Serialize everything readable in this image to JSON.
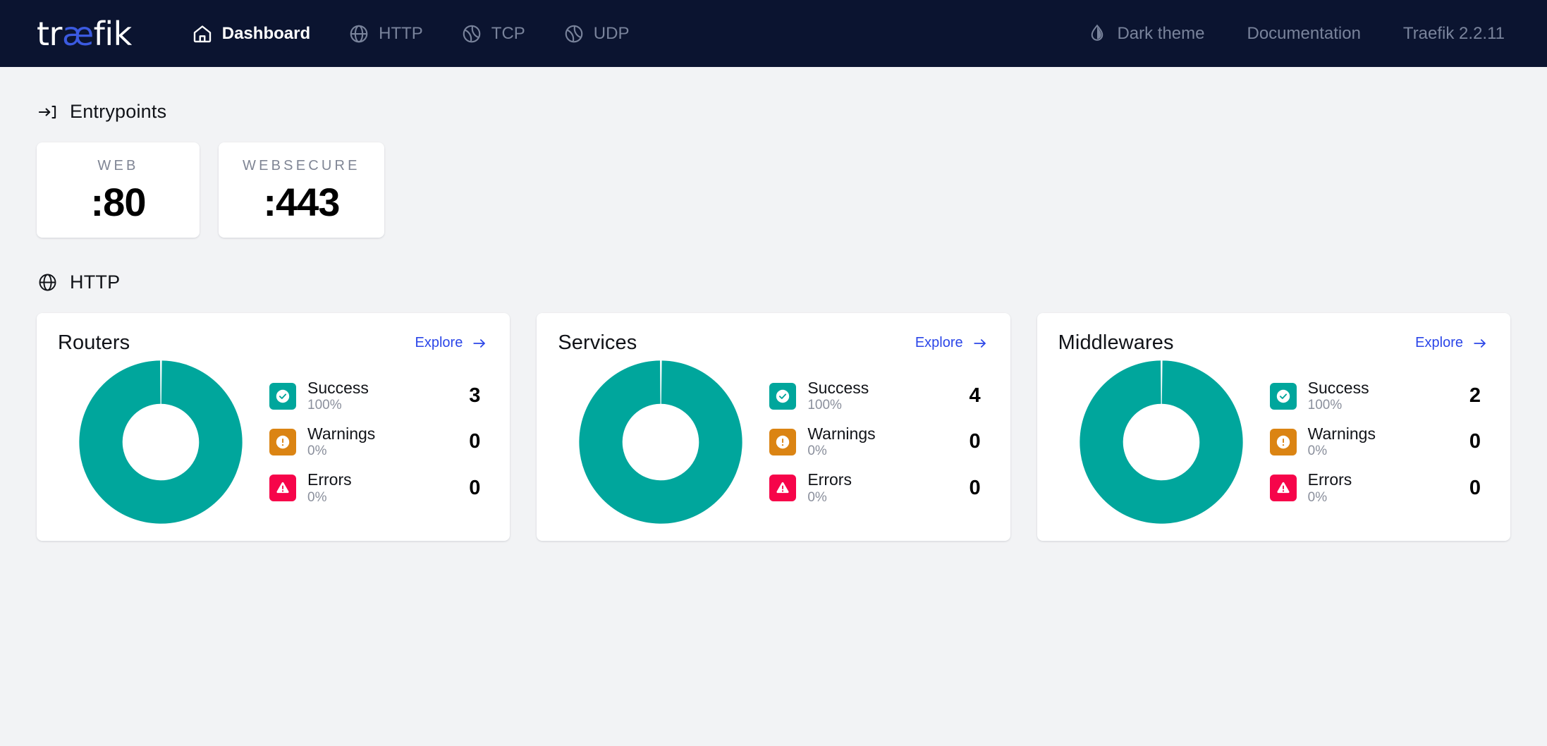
{
  "navbar": {
    "brand": {
      "part1": "tr",
      "part2": "æ",
      "part3": "fik"
    },
    "left_items": [
      {
        "label": "Dashboard",
        "icon": "home-icon",
        "active": true
      },
      {
        "label": "HTTP",
        "icon": "globe-icon",
        "active": false
      },
      {
        "label": "TCP",
        "icon": "sphere-icon",
        "active": false
      },
      {
        "label": "UDP",
        "icon": "sphere-icon",
        "active": false
      }
    ],
    "theme_toggle": {
      "label": "Dark theme",
      "icon": "droplet-half-icon"
    },
    "documentation": {
      "label": "Documentation"
    },
    "version": "Traefik 2.2.11",
    "bg_color": "#0B1430",
    "accent_color": "#3B5AE0"
  },
  "entrypoints_section": {
    "title": "Entrypoints",
    "icon": "arrow-into-bracket-icon",
    "cards": [
      {
        "name": "WEB",
        "port": ":80"
      },
      {
        "name": "WEBSECURE",
        "port": ":443"
      }
    ]
  },
  "http_section": {
    "title": "HTTP",
    "icon": "globe-icon",
    "explore_label": "Explore",
    "cards": [
      {
        "title": "Routers",
        "explore_label": "Explore",
        "legend": [
          {
            "name": "Success",
            "percent": "100%",
            "count": "3",
            "color": "#00A69C",
            "icon": "check-circle-icon"
          },
          {
            "name": "Warnings",
            "percent": "0%",
            "count": "0",
            "color": "#DB8413",
            "icon": "exclamation-circle-icon"
          },
          {
            "name": "Errors",
            "percent": "0%",
            "count": "0",
            "color": "#F6054A",
            "icon": "warning-triangle-icon"
          }
        ]
      },
      {
        "title": "Services",
        "explore_label": "Explore",
        "legend": [
          {
            "name": "Success",
            "percent": "100%",
            "count": "4",
            "color": "#00A69C",
            "icon": "check-circle-icon"
          },
          {
            "name": "Warnings",
            "percent": "0%",
            "count": "0",
            "color": "#DB8413",
            "icon": "exclamation-circle-icon"
          },
          {
            "name": "Errors",
            "percent": "0%",
            "count": "0",
            "color": "#F6054A",
            "icon": "warning-triangle-icon"
          }
        ]
      },
      {
        "title": "Middlewares",
        "explore_label": "Explore",
        "legend": [
          {
            "name": "Success",
            "percent": "100%",
            "count": "2",
            "color": "#00A69C",
            "icon": "check-circle-icon"
          },
          {
            "name": "Warnings",
            "percent": "0%",
            "count": "0",
            "color": "#DB8413",
            "icon": "exclamation-circle-icon"
          },
          {
            "name": "Errors",
            "percent": "0%",
            "count": "0",
            "color": "#F6054A",
            "icon": "warning-triangle-icon"
          }
        ]
      }
    ]
  },
  "chart_data": [
    {
      "type": "pie",
      "title": "Routers",
      "labels": [
        "Success",
        "Warnings",
        "Errors"
      ],
      "values": [
        3,
        0,
        0
      ],
      "percents": [
        100,
        0,
        0
      ],
      "colors": [
        "#00A69C",
        "#DB8413",
        "#F6054A"
      ],
      "donut": true,
      "legend_position": "right"
    },
    {
      "type": "pie",
      "title": "Services",
      "labels": [
        "Success",
        "Warnings",
        "Errors"
      ],
      "values": [
        4,
        0,
        0
      ],
      "percents": [
        100,
        0,
        0
      ],
      "colors": [
        "#00A69C",
        "#DB8413",
        "#F6054A"
      ],
      "donut": true,
      "legend_position": "right"
    },
    {
      "type": "pie",
      "title": "Middlewares",
      "labels": [
        "Success",
        "Warnings",
        "Errors"
      ],
      "values": [
        2,
        0,
        0
      ],
      "percents": [
        100,
        0,
        0
      ],
      "colors": [
        "#00A69C",
        "#DB8413",
        "#F6054A"
      ],
      "donut": true,
      "legend_position": "right"
    }
  ]
}
